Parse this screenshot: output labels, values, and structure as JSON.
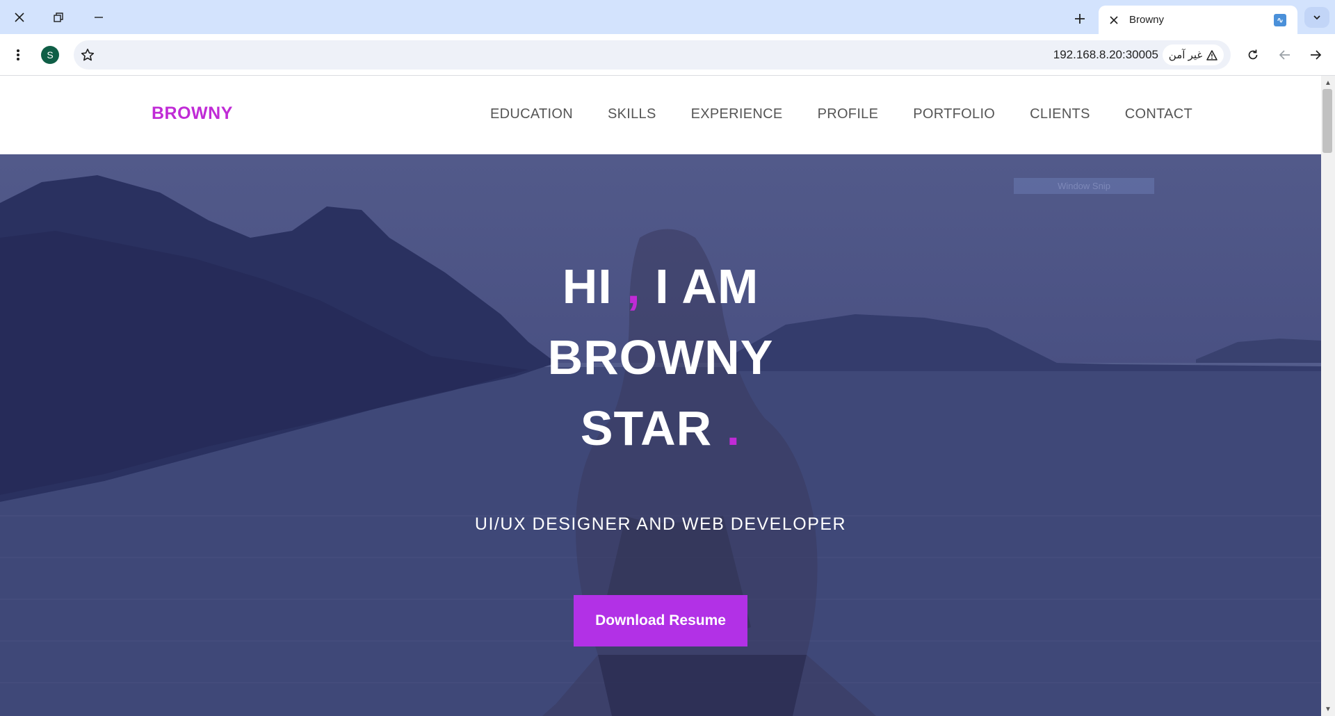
{
  "browser": {
    "tab_title": "Browny",
    "url": "192.168.8.20:30005",
    "security_label": "غير آمن",
    "profile_initial": "S",
    "favicon_glyph": "∿"
  },
  "site": {
    "logo": "BROWNY",
    "nav": [
      "EDUCATION",
      "SKILLS",
      "EXPERIENCE",
      "PROFILE",
      "PORTFOLIO",
      "CLIENTS",
      "CONTACT"
    ],
    "hero": {
      "line1_a": "HI",
      "line1_comma": ",",
      "line1_b": "I AM",
      "line2": "BROWNY",
      "line3": "STAR",
      "line3_dot": ".",
      "subtitle": "UI/UX DESIGNER AND WEB DEVELOPER",
      "cta_label": "Download Resume"
    },
    "overlay_label": "Window Snip"
  },
  "colors": {
    "brand": "#c02bd6",
    "cta": "#b231e6",
    "hero_overlay": "#4a5183",
    "tabbar": "#d3e3fd"
  }
}
